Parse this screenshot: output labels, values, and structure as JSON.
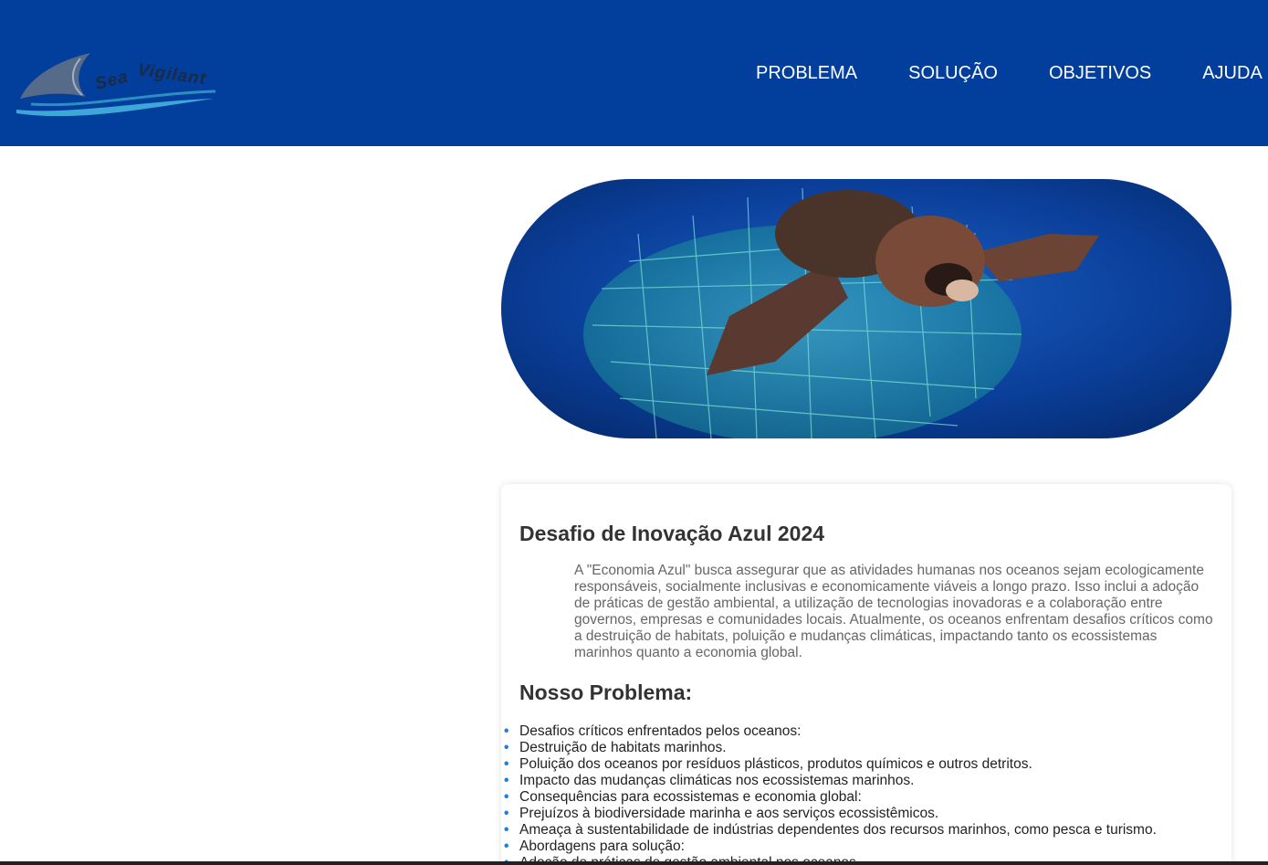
{
  "brand": {
    "name": "SeaVigilant"
  },
  "nav": {
    "problema": "PROBLEMA",
    "solucao": "SOLUÇÃO",
    "objetivos": "OBJETIVOS",
    "ajuda": "AJUDA"
  },
  "colors": {
    "header_bg": "#023e9b",
    "bullet": "#1a7fe0",
    "heading": "#333333",
    "body_text": "#666666"
  },
  "section1": {
    "title": "Desafio de Inovação Azul 2024",
    "intro": "A \"Economia Azul\" busca assegurar que as atividades humanas nos oceanos sejam ecologicamente responsáveis, socialmente inclusivas e economicamente viáveis a longo prazo. Isso inclui a adoção de práticas de gestão ambiental, a utilização de tecnologias inovadoras e a colaboração entre governos, empresas e comunidades locais. Atualmente, os oceanos enfrentam desafios críticos como a destruição de habitats, poluição e mudanças climáticas, impactando tanto os ecossistemas marinhos quanto a economia global."
  },
  "section2": {
    "title": "Nosso Problema:",
    "items": [
      "Desafios críticos enfrentados pelos oceanos:",
      "Destruição de habitats marinhos.",
      "Poluição dos oceanos por resíduos plásticos, produtos químicos e outros detritos.",
      "Impacto das mudanças climáticas nos ecossistemas marinhos.",
      "Consequências para ecossistemas e economia global:",
      "Prejuízos à biodiversidade marinha e aos serviços ecossistêmicos.",
      "Ameaça à sustentabilidade de indústrias dependentes dos recursos marinhos, como pesca e turismo.",
      "Abordagens para solução:",
      "Adoção de práticas de gestão ambiental nos oceanos."
    ]
  }
}
